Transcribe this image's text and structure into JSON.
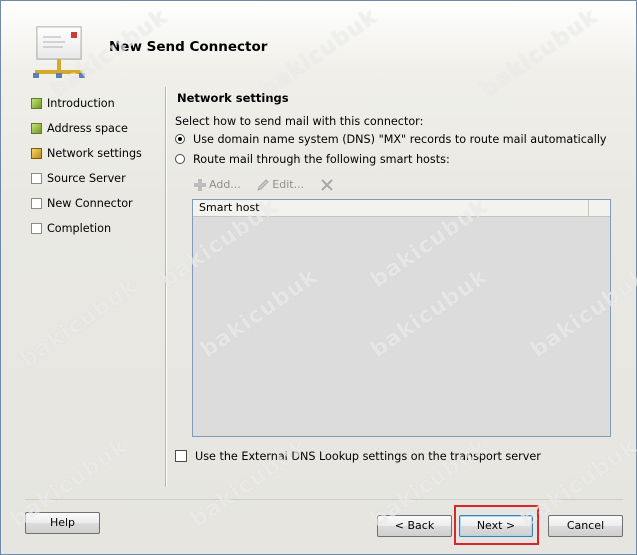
{
  "window": {
    "title": "New Send Connector"
  },
  "steps": [
    {
      "label": "Introduction",
      "state": "done"
    },
    {
      "label": "Address space",
      "state": "done"
    },
    {
      "label": "Network settings",
      "state": "current"
    },
    {
      "label": "Source Server",
      "state": "pending"
    },
    {
      "label": "New Connector",
      "state": "pending"
    },
    {
      "label": "Completion",
      "state": "pending"
    }
  ],
  "network": {
    "title": "Network settings",
    "prompt": "Select how to send mail with this connector:",
    "option_dns": "Use domain name system (DNS) \"MX\" records to route mail automatically",
    "option_smarthost": "Route mail through the following smart hosts:",
    "selected": "dns",
    "toolbar": {
      "add": "Add...",
      "edit": "Edit..."
    },
    "grid": {
      "column": "Smart host",
      "rows": []
    },
    "external_dns_label": "Use the External DNS Lookup settings on the transport server",
    "external_dns_checked": false
  },
  "buttons": {
    "help": "Help",
    "back": "< Back",
    "next": "Next >",
    "cancel": "Cancel"
  },
  "watermark": "bakicubuk",
  "colors": {
    "highlight": "#d9262c",
    "done_step": "#8bb33a",
    "current_step": "#e0ad2a"
  }
}
